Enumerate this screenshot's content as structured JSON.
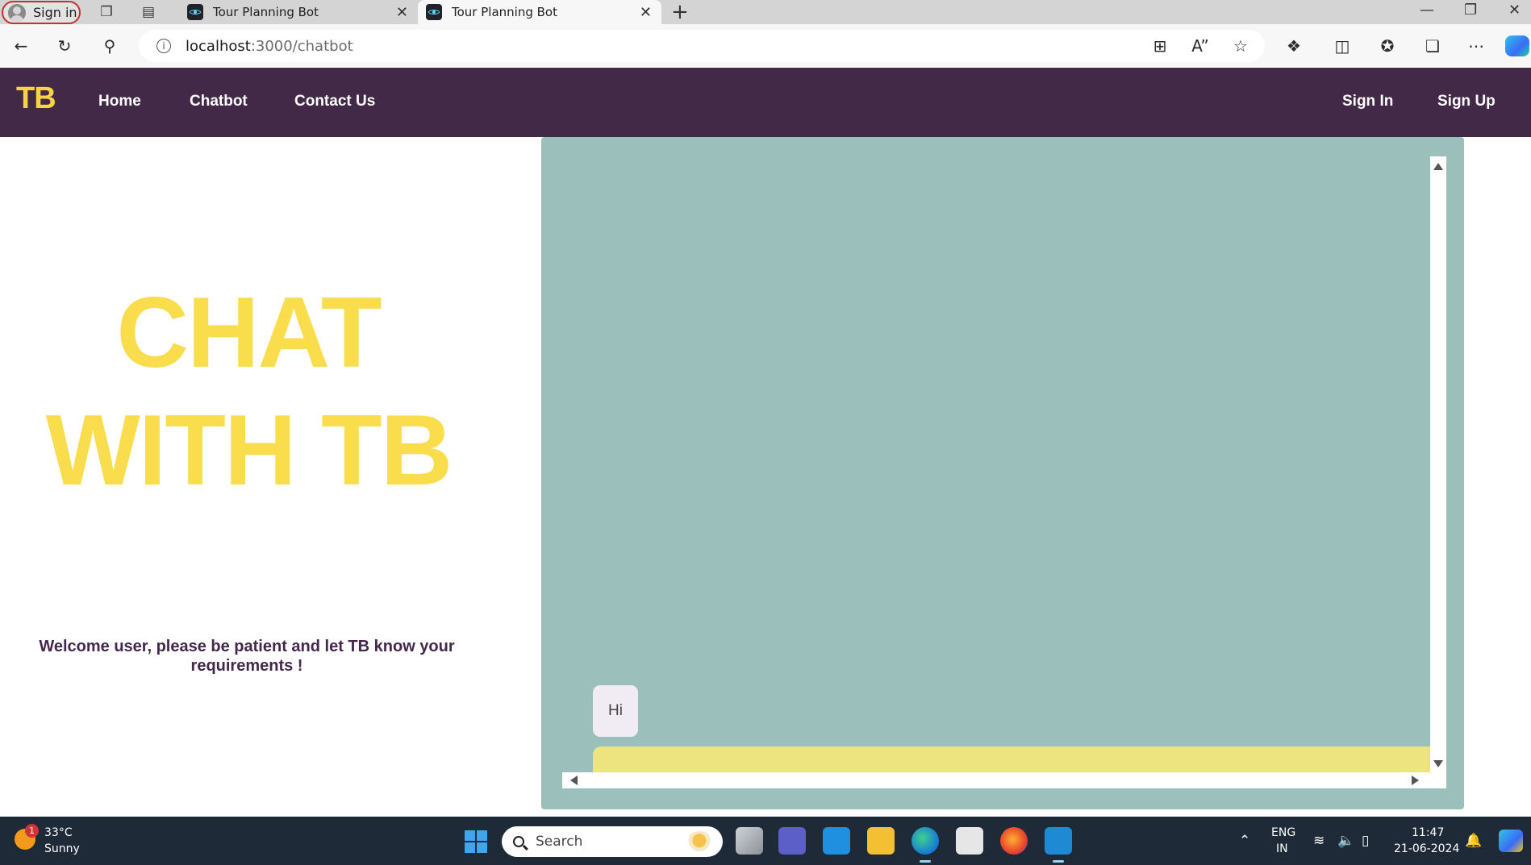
{
  "browser": {
    "profile_label": "Sign in",
    "tabs": [
      {
        "title": "Tour Planning Bot",
        "active": false
      },
      {
        "title": "Tour Planning Bot",
        "active": true
      }
    ],
    "new_tab_glyph": "+",
    "url_host": "localhost",
    "url_path": ":3000/chatbot",
    "icons": [
      "back-arrow-icon",
      "refresh-icon",
      "search-icon",
      "app-grid-icon",
      "read-aloud-icon",
      "favorite-star-icon",
      "extensions-icon",
      "split-screen-icon",
      "favorites-icon",
      "collections-icon",
      "more-icon",
      "copilot-icon"
    ]
  },
  "navbar": {
    "logo": "TB",
    "links": [
      "Home",
      "Chatbot",
      "Contact Us"
    ],
    "auth": [
      "Sign In",
      "Sign Up"
    ]
  },
  "hero": {
    "title_line1": "CHAT",
    "title_line2": "WITH TB",
    "welcome": "Welcome user, please be patient and let TB know your requirements !"
  },
  "chat": {
    "messages": [
      {
        "from": "user",
        "text": "Hi"
      }
    ],
    "input_value": ""
  },
  "taskbar": {
    "weather_temp": "33°C",
    "weather_desc": "Sunny",
    "weather_badge": "1",
    "search_placeholder": "Search",
    "lang_line1": "ENG",
    "lang_line2": "IN",
    "time": "11:47",
    "date": "21-06-2024"
  },
  "colors": {
    "navbar_bg": "#432948",
    "logo_yellow": "#f7d446",
    "hero_yellow": "#f9dd4d",
    "chat_bg": "#9bc0bc",
    "input_bg": "#ede47f",
    "welcome_text": "#44284c"
  }
}
